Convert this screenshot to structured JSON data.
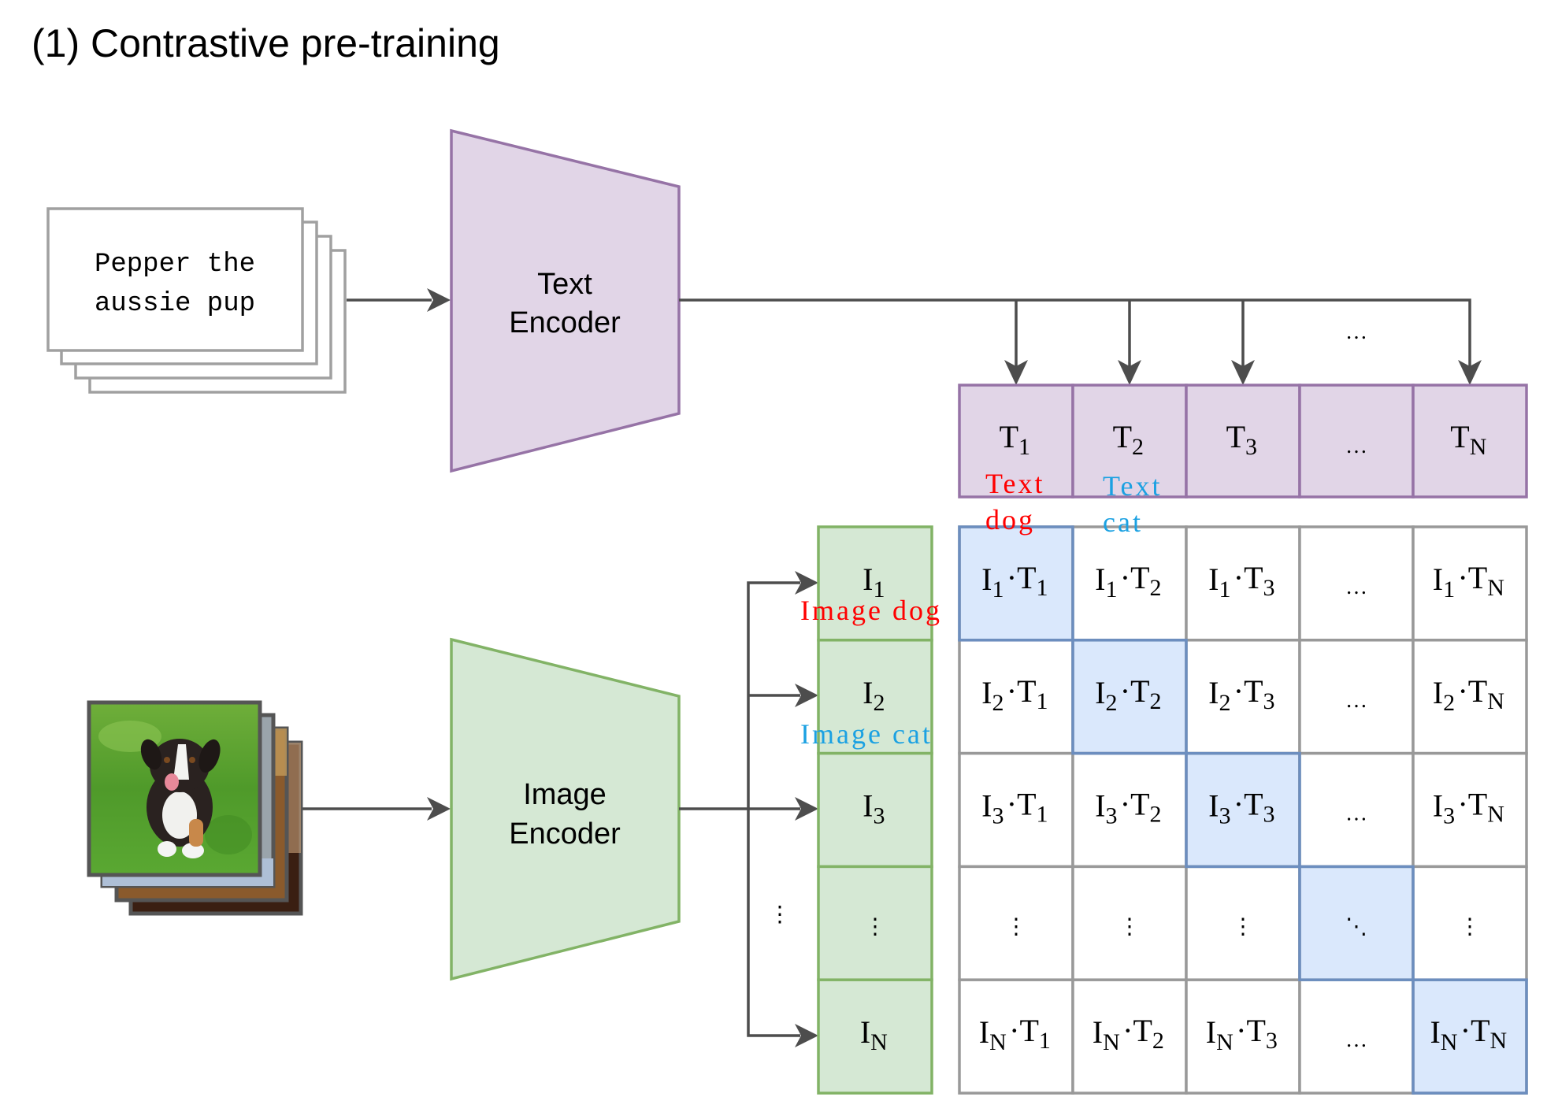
{
  "title": "(1) Contrastive pre-training",
  "text_input": {
    "lines": [
      "Pepper the",
      "aussie pup"
    ],
    "stack_count": 4
  },
  "image_input": {
    "description": "puppy photo on grass (front of a stack of images)",
    "stack_count": 4
  },
  "text_encoder": {
    "line1": "Text",
    "line2": "Encoder"
  },
  "image_encoder": {
    "line1": "Image",
    "line2": "Encoder"
  },
  "text_embeddings": [
    {
      "base": "T",
      "sub": "1"
    },
    {
      "base": "T",
      "sub": "2"
    },
    {
      "base": "T",
      "sub": "3"
    },
    {
      "base": "…",
      "sub": ""
    },
    {
      "base": "T",
      "sub": "N"
    }
  ],
  "text_arrows_ellipsis": "…",
  "image_embeddings": [
    {
      "base": "I",
      "sub": "1"
    },
    {
      "base": "I",
      "sub": "2"
    },
    {
      "base": "I",
      "sub": "3"
    },
    {
      "base": "⋮",
      "sub": ""
    },
    {
      "base": "I",
      "sub": "N"
    }
  ],
  "image_arrows_ellipsis": "⋮",
  "similarity_matrix": {
    "rows": [
      [
        "I1·T1",
        "I1·T2",
        "I1·T3",
        "…",
        "I1·TN"
      ],
      [
        "I2·T1",
        "I2·T2",
        "I2·T3",
        "…",
        "I2·TN"
      ],
      [
        "I3·T1",
        "I3·T2",
        "I3·T3",
        "…",
        "I3·TN"
      ],
      [
        "⋮",
        "⋮",
        "⋮",
        "⋱",
        "⋮"
      ],
      [
        "IN·T1",
        "IN·T2",
        "IN·T3",
        "…",
        "IN·TN"
      ]
    ],
    "highlight": "diagonal"
  },
  "annotations": {
    "text_dog": {
      "line1": "Text",
      "line2": "dog",
      "color": "#ff0000"
    },
    "text_cat": {
      "line1": "Text",
      "line2": "cat",
      "color": "#1ba1e2"
    },
    "image_dog": {
      "label": "Image dog",
      "color": "#ff0000"
    },
    "image_cat": {
      "label": "Image cat",
      "color": "#1ba1e2"
    }
  },
  "colors": {
    "text_fill": "#e1d5e7",
    "text_stroke": "#9673a6",
    "image_fill": "#d5e8d4",
    "image_stroke": "#82b366",
    "diag_fill": "#dae8fc",
    "diag_stroke": "#6c8ebf",
    "grid_stroke": "#999999",
    "arrow": "#4d4d4d"
  }
}
